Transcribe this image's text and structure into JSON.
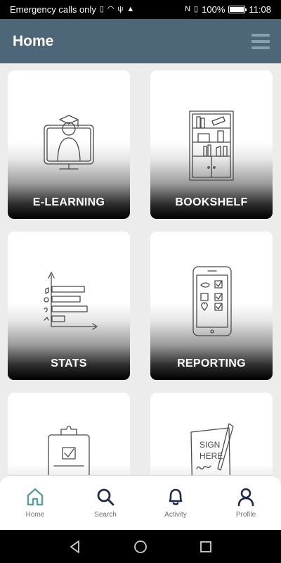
{
  "status_bar": {
    "carrier": "Emergency calls only",
    "battery": "100%",
    "time": "11:08"
  },
  "app_bar": {
    "title": "Home"
  },
  "tiles": [
    {
      "label": "E-LEARNING",
      "icon": "e-learning-illustration"
    },
    {
      "label": "BOOKSHELF",
      "icon": "bookshelf-illustration"
    },
    {
      "label": "STATS",
      "icon": "stats-illustration"
    },
    {
      "label": "REPORTING",
      "icon": "reporting-illustration"
    },
    {
      "label": "",
      "icon": "clipboard-illustration"
    },
    {
      "label": "",
      "icon": "sign-here-illustration"
    }
  ],
  "bottom_nav": {
    "items": [
      {
        "label": "Home",
        "icon": "home-icon",
        "active": true
      },
      {
        "label": "Search",
        "icon": "search-icon"
      },
      {
        "label": "Activity",
        "icon": "bell-icon"
      },
      {
        "label": "Profile",
        "icon": "profile-icon"
      }
    ]
  },
  "colors": {
    "app_bar": "#4d6778",
    "active_nav": "#5f9e9a",
    "inactive_nav": "#1f2a4a"
  }
}
